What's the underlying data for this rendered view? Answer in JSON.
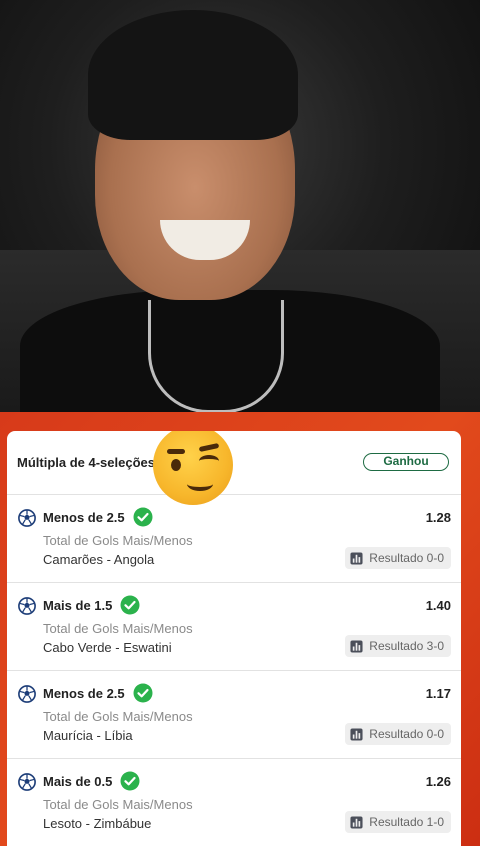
{
  "bet": {
    "title": "Múltipla de 4-seleções",
    "status": "Ganhou",
    "emoji": "winking-face",
    "colors": {
      "accent_orange": "#e24a1c",
      "status_green": "#1e6b43",
      "check_green": "#2bb24c"
    },
    "selections": [
      {
        "pick": "Menos de 2.5",
        "odds": "1.28",
        "market": "Total de Gols Mais/Menos",
        "event": "Camarões - Angola",
        "result": "Resultado 0-0"
      },
      {
        "pick": "Mais de 1.5",
        "odds": "1.40",
        "market": "Total de Gols Mais/Menos",
        "event": "Cabo Verde - Eswatini",
        "result": "Resultado 3-0"
      },
      {
        "pick": "Menos de 2.5",
        "odds": "1.17",
        "market": "Total de Gols Mais/Menos",
        "event": "Maurícia - Líbia",
        "result": "Resultado 0-0"
      },
      {
        "pick": "Mais de 0.5",
        "odds": "1.26",
        "market": "Total de Gols Mais/Menos",
        "event": "Lesoto - Zimbábue",
        "result": "Resultado 1-0"
      }
    ]
  }
}
